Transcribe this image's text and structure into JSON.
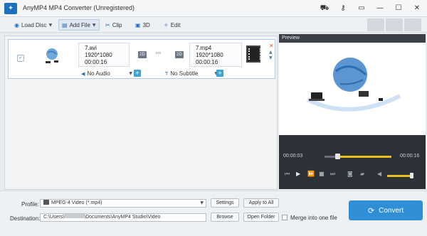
{
  "window": {
    "title": "AnyMP4 MP4 Converter (Unregistered)"
  },
  "toolbar": {
    "load_disc": "Load Disc",
    "add_file": "Add File",
    "clip": "Clip",
    "three_d": "3D",
    "edit": "Edit"
  },
  "file": {
    "source": {
      "name": "7.avi",
      "resolution": "1920*1080",
      "duration": "00:00:16",
      "mode": "2D"
    },
    "output": {
      "name": "7.mp4",
      "resolution": "1920*1080",
      "duration": "00:00:16",
      "mode": "2D"
    },
    "audio": "No Audio",
    "subtitle": "No Subtitle"
  },
  "preview": {
    "label": "Preview",
    "time_current": "00:00:03",
    "time_total": "00:00:16",
    "progress": 0.19,
    "volume": 0.85
  },
  "bottom": {
    "profile_label": "Profile:",
    "profile_value": "MPEG-4 Video (*.mp4)",
    "settings": "Settings",
    "apply_to_all": "Apply to All",
    "destination_label": "Destination:",
    "destination_value": "C:\\Users\\",
    "destination_value_tail": "\\Documents\\AnyMP4 Studio\\Video",
    "browse": "Browse",
    "open_folder": "Open Folder",
    "merge": "Merge into one file",
    "convert": "Convert"
  },
  "colors": {
    "accent": "#2e8fd6",
    "progress": "#e8c21a",
    "preview_bg": "#2c3037"
  }
}
